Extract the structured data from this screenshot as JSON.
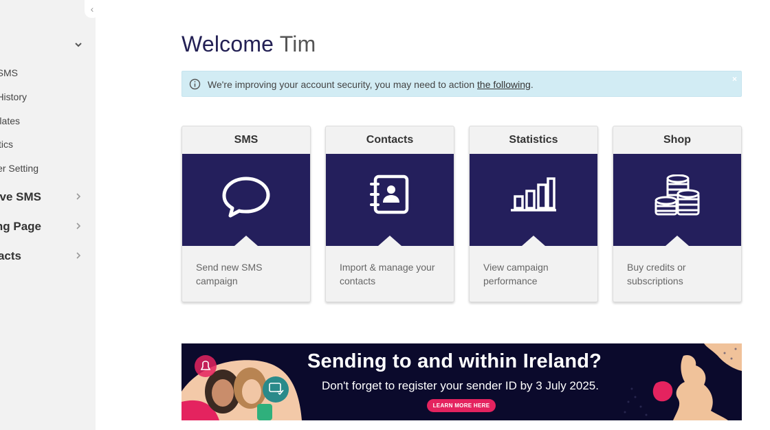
{
  "sidebar": {
    "collapse_glyph": "‹",
    "sub_items": [
      {
        "label": "SMS"
      },
      {
        "label": "History"
      },
      {
        "label": "lates"
      },
      {
        "label": "tics"
      },
      {
        "label": "er Setting"
      }
    ],
    "main_items": [
      {
        "label": "ive SMS"
      },
      {
        "label": "ing Page"
      },
      {
        "label": "acts"
      }
    ]
  },
  "header": {
    "welcome": "Welcome",
    "name": "Tim"
  },
  "alert": {
    "message": "We're improving your account security, you may need to action ",
    "link": "the following",
    "suffix": ".",
    "close_glyph": "×",
    "background": "#d2ecf4"
  },
  "cards": [
    {
      "title": "SMS",
      "description": "Send new SMS campaign",
      "icon": "speech-bubble-icon"
    },
    {
      "title": "Contacts",
      "description": "Import & manage your contacts",
      "icon": "address-book-icon"
    },
    {
      "title": "Statistics",
      "description": "View campaign performance",
      "icon": "bar-chart-icon"
    },
    {
      "title": "Shop",
      "description": "Buy credits or subscriptions",
      "icon": "coins-icon"
    }
  ],
  "banner": {
    "headline": "Sending to and within Ireland?",
    "subline": "Don't forget to register your sender ID by 3 July 2025.",
    "cta": "LEARN MORE HERE",
    "background": "#0b0a2c",
    "accent": "#e4235f"
  },
  "colors": {
    "brand_navy": "#241f5c",
    "title": "#232054"
  }
}
